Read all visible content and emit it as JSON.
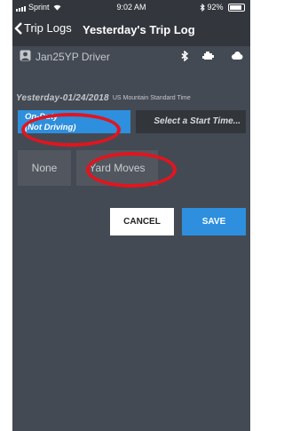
{
  "status_bar": {
    "carrier": "Sprint",
    "time": "9:02 AM",
    "battery": "92%",
    "battery_level": 0.92,
    "icons": [
      "signal-icon",
      "wifi-icon",
      "bluetooth-icon",
      "battery-icon"
    ]
  },
  "nav": {
    "back_label": "Trip Logs",
    "title": "Yesterday's Trip Log"
  },
  "driver": {
    "name": "Jan25YP Driver",
    "icons": [
      "person-icon",
      "bluetooth-icon",
      "truck-icon",
      "cloud-icon"
    ]
  },
  "log": {
    "date": "Yesterday-01/24/2018",
    "timezone": "US Mountain Standard Time"
  },
  "duty_status": {
    "line1": "On-Duty",
    "line2": "(Not Driving)"
  },
  "start_time": {
    "label": "Select a Start Time..."
  },
  "options": {
    "none": "None",
    "yard_moves": "Yard Moves"
  },
  "actions": {
    "cancel": "CANCEL",
    "save": "SAVE"
  },
  "colors": {
    "background": "#444a53",
    "header": "#33373d",
    "accent": "#2d8fdd",
    "annotation": "#e3141e"
  }
}
